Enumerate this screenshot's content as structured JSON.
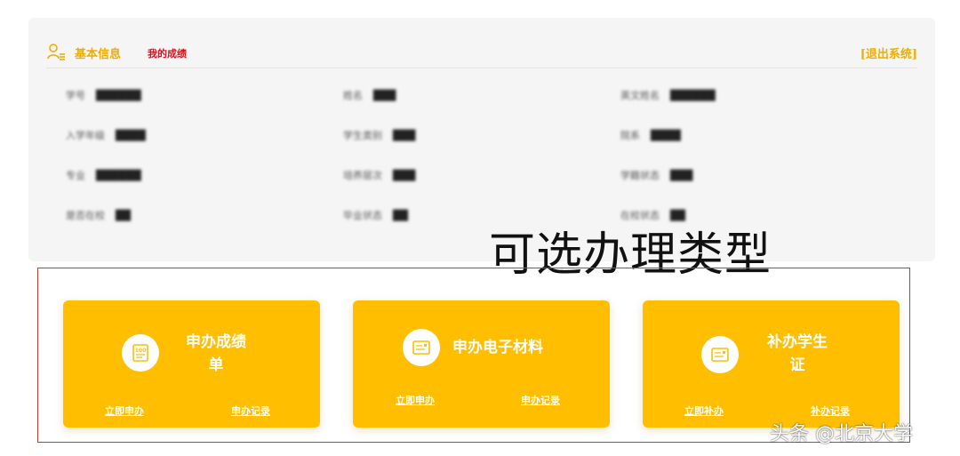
{
  "header": {
    "user_icon": "user-list-icon",
    "tab_basic_info": "基本信息",
    "tab_my_scores": "我的成绩",
    "logout": "[退出系统]"
  },
  "info_fields": [
    {
      "label": "学号",
      "value": "██████"
    },
    {
      "label": "姓名",
      "value": "███"
    },
    {
      "label": "英文姓名",
      "value": "██████"
    },
    {
      "label": "入学年级",
      "value": "████"
    },
    {
      "label": "学生类别",
      "value": "███"
    },
    {
      "label": "院系",
      "value": "████"
    },
    {
      "label": "专业",
      "value": "██████"
    },
    {
      "label": "培养层次",
      "value": "███"
    },
    {
      "label": "学籍状态",
      "value": "███"
    },
    {
      "label": "是否在校",
      "value": "██"
    },
    {
      "label": "毕业状态",
      "value": "██"
    },
    {
      "label": "在校状态",
      "value": "██"
    }
  ],
  "overlay_title": "可选办理类型",
  "services": [
    {
      "icon": "score-sheet-icon",
      "title": "申办成绩单",
      "apply": "立即申办",
      "record": "申办记录"
    },
    {
      "icon": "document-icon",
      "title": "申办电子材料",
      "apply": "立即申办",
      "record": "申办记录"
    },
    {
      "icon": "card-icon",
      "title": "补办学生证",
      "apply": "立即补办",
      "record": "补办记录"
    }
  ],
  "watermark": "头条 @北京大学",
  "colors": {
    "accent": "#f0ad00",
    "card": "#ffbe00",
    "active_tab": "#d8121b",
    "frame": "#b8422e",
    "panel": "#f5f5f5"
  }
}
